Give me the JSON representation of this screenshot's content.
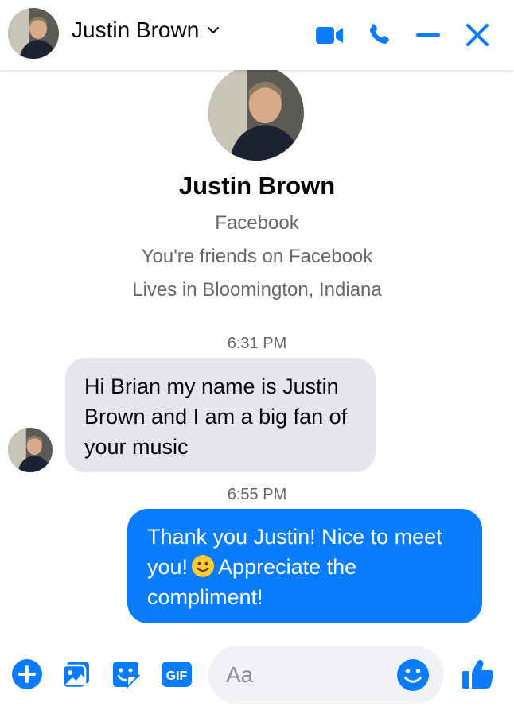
{
  "header": {
    "contact_name": "Justin Brown"
  },
  "profile": {
    "name": "Justin Brown",
    "platform": "Facebook",
    "friendship": "You're friends on Facebook",
    "location": "Lives in Bloomington, Indiana"
  },
  "messages": [
    {
      "timestamp": "6:31 PM",
      "direction": "incoming",
      "text": "Hi Brian my name is Justin Brown and I am a big fan of your music"
    },
    {
      "timestamp": "6:55 PM",
      "direction": "outgoing",
      "text_before_emoji": "Thank you Justin!  Nice to meet you!",
      "text_after_emoji": "Appreciate the compliment!"
    }
  ],
  "composer": {
    "placeholder": "Aa"
  },
  "colors": {
    "accent": "#0a7cff",
    "incoming_bubble": "#e4e6eb",
    "secondary_text": "#65676b"
  },
  "icons": [
    "video-call-icon",
    "phone-call-icon",
    "minimize-icon",
    "close-icon",
    "chevron-down-icon",
    "plus-icon",
    "photo-icon",
    "sticker-icon",
    "gif-icon",
    "emoji-icon",
    "thumbs-up-icon"
  ]
}
